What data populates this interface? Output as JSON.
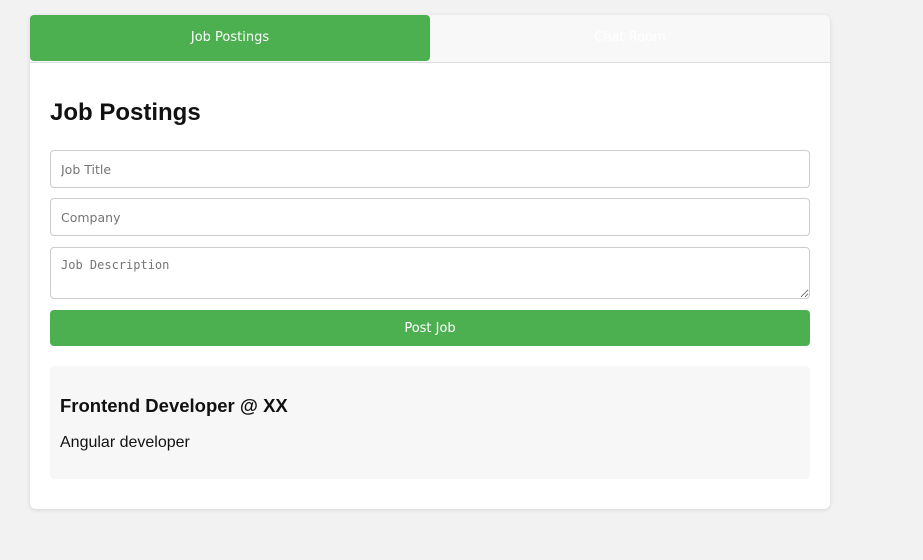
{
  "tabs": [
    {
      "label": "Job Postings",
      "active": true
    },
    {
      "label": "Chat Room",
      "active": false
    }
  ],
  "page": {
    "title": "Job Postings"
  },
  "form": {
    "job_title_placeholder": "Job Title",
    "company_placeholder": "Company",
    "description_placeholder": "Job Description",
    "submit_label": "Post Job"
  },
  "postings": [
    {
      "title": "Frontend Developer @ XX",
      "description": "Angular developer"
    }
  ],
  "colors": {
    "accent": "#4caf50",
    "background": "#f2f2f2",
    "card": "#ffffff",
    "posting_background": "#f7f7f7"
  }
}
